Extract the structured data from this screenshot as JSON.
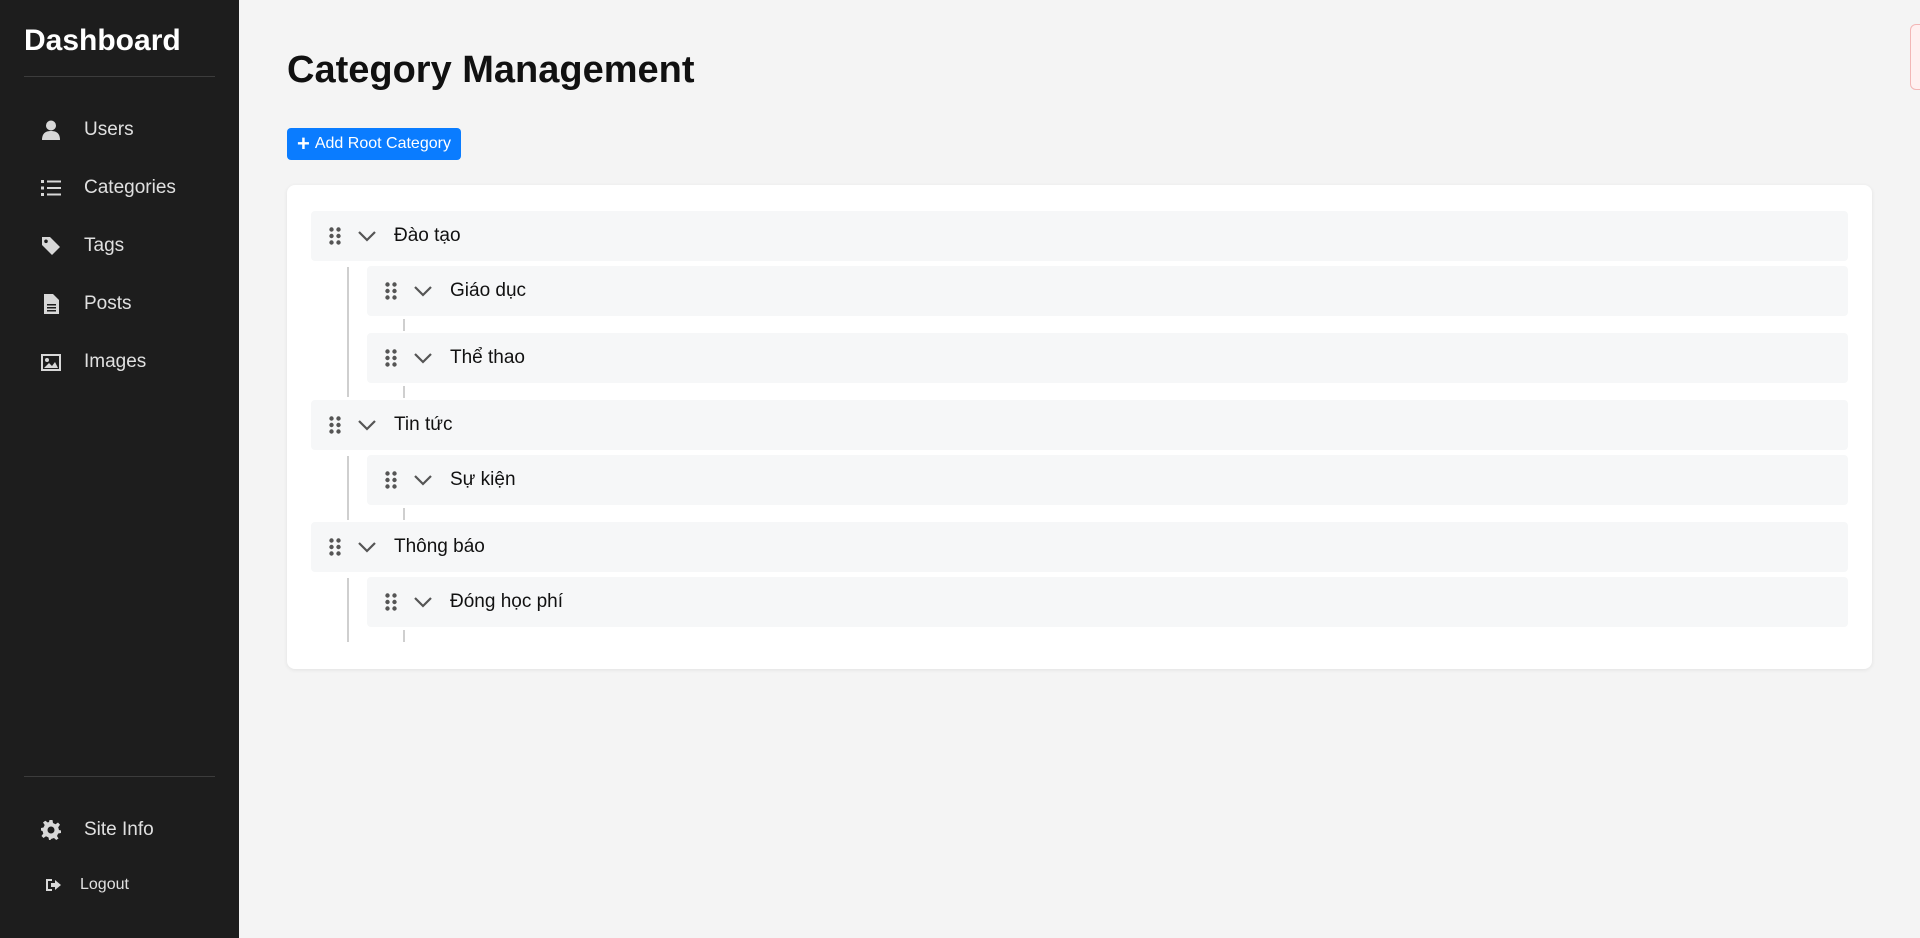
{
  "sidebar": {
    "title": "Dashboard",
    "items": [
      {
        "label": "Users",
        "icon": "user-icon"
      },
      {
        "label": "Categories",
        "icon": "list-icon"
      },
      {
        "label": "Tags",
        "icon": "tag-icon"
      },
      {
        "label": "Posts",
        "icon": "file-icon"
      },
      {
        "label": "Images",
        "icon": "image-icon"
      }
    ],
    "site_info": {
      "label": "Site Info",
      "icon": "gear-icon"
    },
    "logout": {
      "label": "Logout",
      "icon": "logout-icon"
    }
  },
  "main": {
    "title": "Category Management",
    "add_root_label": "Add Root Category"
  },
  "tree": [
    {
      "label": "Đào tạo",
      "children": [
        {
          "label": "Giáo dục"
        },
        {
          "label": "Thể thao"
        }
      ]
    },
    {
      "label": "Tin tức",
      "children": [
        {
          "label": "Sự kiện"
        }
      ]
    },
    {
      "label": "Thông báo",
      "children": [
        {
          "label": "Đóng học phí"
        }
      ]
    }
  ],
  "colors": {
    "sidebar_bg": "#1d1d1d",
    "accent": "#0a7cff",
    "page_bg": "#f4f4f4"
  }
}
